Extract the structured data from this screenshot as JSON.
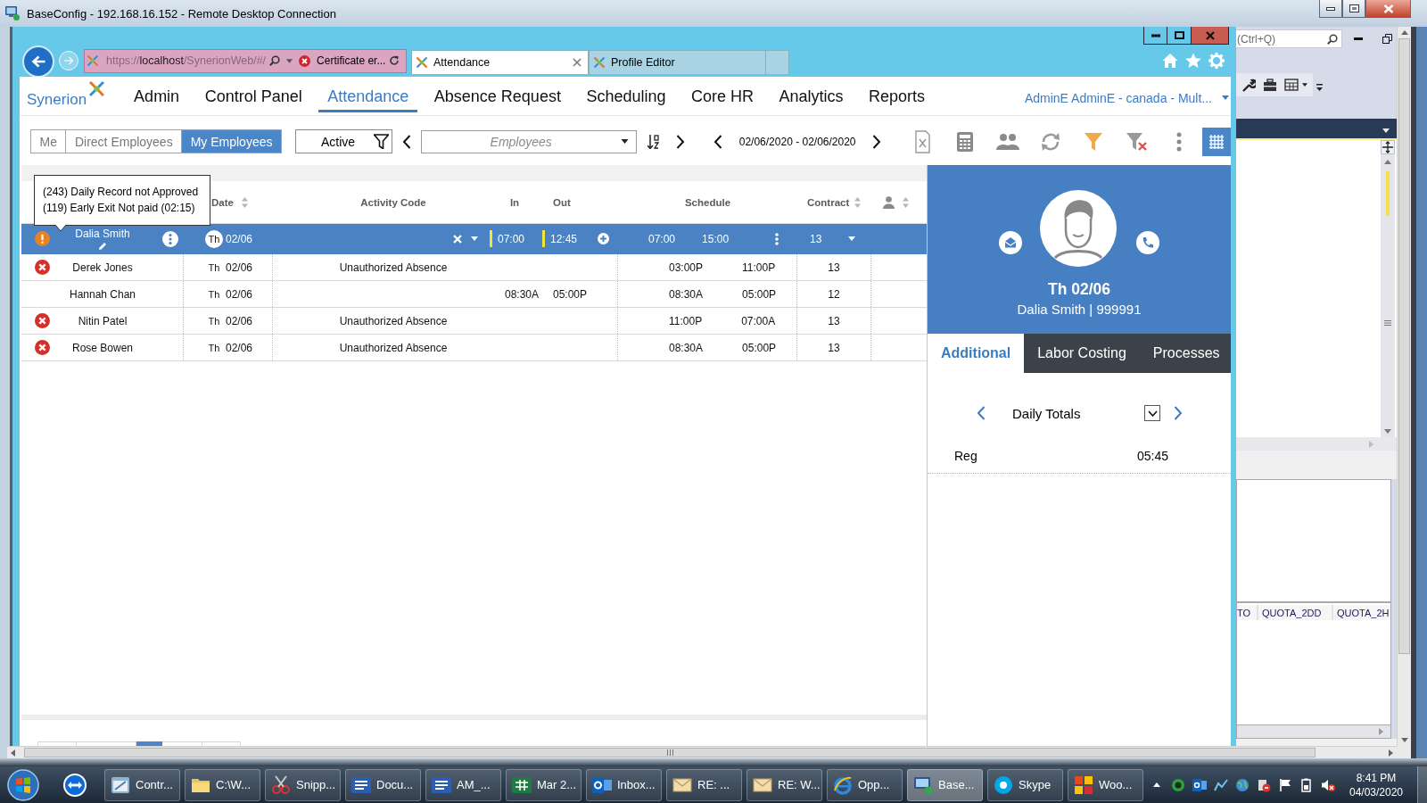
{
  "rdp_window": {
    "title": "BaseConfig - 192.168.16.152 - Remote Desktop Connection"
  },
  "browser": {
    "address": {
      "scheme": "https://",
      "host": "localhost",
      "path": "/SynerionWeb/#/"
    },
    "certificate_error": "Certificate er...",
    "tabs": [
      {
        "label": "Attendance",
        "selected": true
      },
      {
        "label": "Profile Editor",
        "selected": false
      }
    ]
  },
  "app": {
    "logo": "Synerion",
    "menu": [
      {
        "label": "Admin",
        "selected": false
      },
      {
        "label": "Control Panel",
        "selected": false
      },
      {
        "label": "Attendance",
        "selected": true
      },
      {
        "label": "Absence Request",
        "selected": false
      },
      {
        "label": "Scheduling",
        "selected": false
      },
      {
        "label": "Core HR",
        "selected": false
      },
      {
        "label": "Analytics",
        "selected": false
      },
      {
        "label": "Reports",
        "selected": false
      }
    ],
    "user": "AdminE AdminE - canada - Mult..."
  },
  "toolbar": {
    "scope": [
      {
        "label": "Me",
        "selected": false
      },
      {
        "label": "Direct Employees",
        "selected": false
      },
      {
        "label": "My Employees",
        "selected": true
      }
    ],
    "status_filter": "Active",
    "employees": {
      "placeholder": "Employees"
    },
    "date_range": "02/06/2020 - 02/06/2020",
    "grid_view": {
      "selected": true
    }
  },
  "table": {
    "columns": [
      {
        "label": "Date",
        "sortable": true
      },
      {
        "label": "Activity Code",
        "sortable": false
      },
      {
        "label": "In",
        "sortable": false
      },
      {
        "label": "Out",
        "sortable": false
      },
      {
        "label": "Schedule",
        "sortable": false
      },
      {
        "label": "Contract",
        "sortable": true
      }
    ],
    "rows": [
      {
        "kind": "warning",
        "name": "Dalia Smith",
        "day": "Th",
        "date": "02/06",
        "in": "07:00",
        "out": "12:45",
        "schedule_start": "07:00",
        "schedule_end": "15:00",
        "contract": "13",
        "selected": true
      },
      {
        "kind": "error",
        "name": "Derek Jones",
        "day": "Th",
        "date": "02/06",
        "activity": "Unauthorized Absence",
        "schedule_start": "03:00P",
        "schedule_end": "11:00P",
        "contract": "13",
        "selected": false
      },
      {
        "kind": "plain",
        "name": "Hannah Chan",
        "day": "Th",
        "date": "02/06",
        "in": "08:30A",
        "out": "05:00P",
        "schedule_start": "08:30A",
        "schedule_end": "05:00P",
        "contract": "12",
        "selected": false
      },
      {
        "kind": "error",
        "name": "Nitin Patel",
        "day": "Th",
        "date": "02/06",
        "activity": "Unauthorized Absence",
        "schedule_start": "11:00P",
        "schedule_end": "07:00A",
        "contract": "13",
        "selected": false
      },
      {
        "kind": "error",
        "name": "Rose Bowen",
        "day": "Th",
        "date": "02/06",
        "activity": "Unauthorized Absence",
        "schedule_start": "08:30A",
        "schedule_end": "05:00P",
        "contract": "13",
        "selected": false
      }
    ],
    "tooltip": [
      "(243) Daily Record not Approved",
      "(119) Early Exit Not paid (02:15)"
    ]
  },
  "detail_panel": {
    "date": "Th 02/06",
    "employee": "Dalia Smith | 999991",
    "tabs": [
      {
        "label": "Additional",
        "selected": true
      },
      {
        "label": "Labor Costing",
        "selected": false
      },
      {
        "label": "Processes",
        "selected": false
      }
    ],
    "totals_title": "Daily Totals",
    "totals": [
      {
        "label": "Reg",
        "value": "05:45"
      }
    ]
  },
  "side_app": {
    "search": {
      "placeholder": "(Ctrl+Q)"
    },
    "grid_columns": [
      "TO",
      "QUOTA_2DD",
      "QUOTA_2H"
    ]
  },
  "taskbar": {
    "items": [
      {
        "kind": "window",
        "label": "Contr...",
        "selected": false
      },
      {
        "kind": "folder",
        "label": "C:\\W...",
        "selected": false
      },
      {
        "kind": "scissors",
        "label": "Snipp...",
        "selected": false
      },
      {
        "kind": "word",
        "label": "Docu...",
        "selected": false
      },
      {
        "kind": "word",
        "label": "AM_...",
        "selected": false
      },
      {
        "kind": "excel",
        "label": "Mar 2...",
        "selected": false
      },
      {
        "kind": "outlook",
        "label": "Inbox...",
        "selected": false
      },
      {
        "kind": "mail",
        "label": "RE: ...",
        "selected": false
      },
      {
        "kind": "mail",
        "label": "RE: W...",
        "selected": false
      },
      {
        "kind": "ie",
        "label": "Opp...",
        "selected": false
      },
      {
        "kind": "remote",
        "label": "Base...",
        "selected": true
      },
      {
        "kind": "skype",
        "label": "Skype",
        "selected": false
      },
      {
        "kind": "tiles",
        "label": "Woo...",
        "selected": false
      }
    ],
    "clock": {
      "time": "8:41 PM",
      "date": "04/03/2020"
    }
  }
}
